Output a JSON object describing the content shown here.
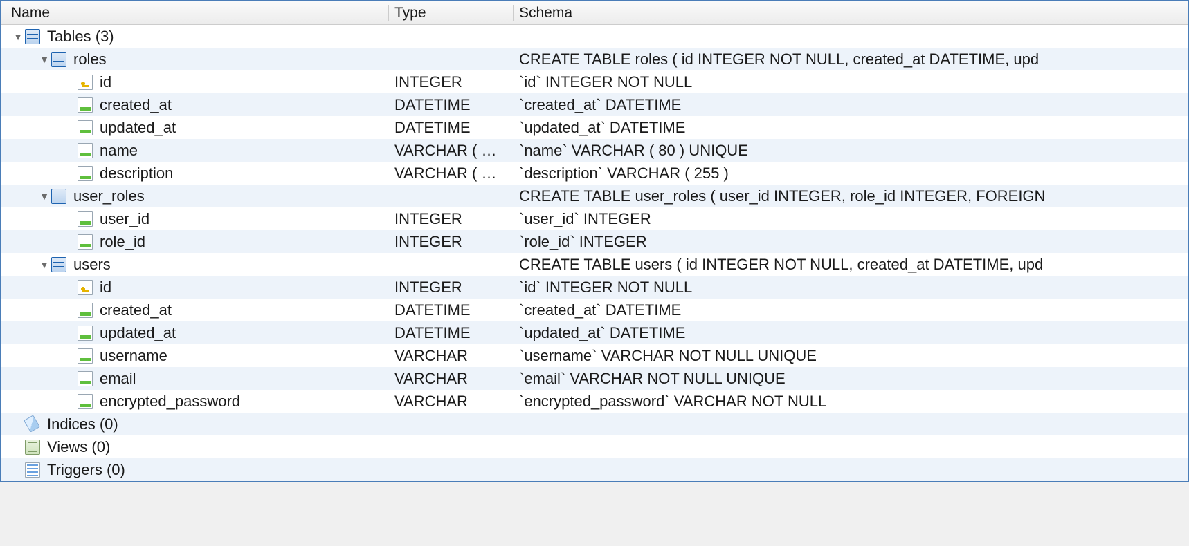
{
  "columns": {
    "name": "Name",
    "type": "Type",
    "schema": "Schema"
  },
  "tree": [
    {
      "depth": 0,
      "expand": "open",
      "icon": "table",
      "name": "Tables (3)",
      "type": "",
      "schema": ""
    },
    {
      "depth": 1,
      "expand": "open",
      "icon": "table",
      "name": "roles",
      "type": "",
      "schema": "CREATE TABLE roles ( id INTEGER NOT NULL, created_at DATETIME, upd"
    },
    {
      "depth": 2,
      "expand": "",
      "icon": "key",
      "name": "id",
      "type": "INTEGER",
      "schema": "`id` INTEGER NOT NULL"
    },
    {
      "depth": 2,
      "expand": "",
      "icon": "col",
      "name": "created_at",
      "type": "DATETIME",
      "schema": "`created_at` DATETIME"
    },
    {
      "depth": 2,
      "expand": "",
      "icon": "col",
      "name": "updated_at",
      "type": "DATETIME",
      "schema": "`updated_at` DATETIME"
    },
    {
      "depth": 2,
      "expand": "",
      "icon": "col",
      "name": "name",
      "type": "VARCHAR ( …",
      "schema": "`name` VARCHAR ( 80 ) UNIQUE"
    },
    {
      "depth": 2,
      "expand": "",
      "icon": "col",
      "name": "description",
      "type": "VARCHAR ( …",
      "schema": "`description` VARCHAR ( 255 )"
    },
    {
      "depth": 1,
      "expand": "open",
      "icon": "table",
      "name": "user_roles",
      "type": "",
      "schema": "CREATE TABLE user_roles ( user_id INTEGER, role_id INTEGER, FOREIGN"
    },
    {
      "depth": 2,
      "expand": "",
      "icon": "col",
      "name": "user_id",
      "type": "INTEGER",
      "schema": "`user_id` INTEGER"
    },
    {
      "depth": 2,
      "expand": "",
      "icon": "col",
      "name": "role_id",
      "type": "INTEGER",
      "schema": "`role_id` INTEGER"
    },
    {
      "depth": 1,
      "expand": "open",
      "icon": "table",
      "name": "users",
      "type": "",
      "schema": "CREATE TABLE users ( id INTEGER NOT NULL, created_at DATETIME, upd"
    },
    {
      "depth": 2,
      "expand": "",
      "icon": "key",
      "name": "id",
      "type": "INTEGER",
      "schema": "`id` INTEGER NOT NULL"
    },
    {
      "depth": 2,
      "expand": "",
      "icon": "col",
      "name": "created_at",
      "type": "DATETIME",
      "schema": "`created_at` DATETIME"
    },
    {
      "depth": 2,
      "expand": "",
      "icon": "col",
      "name": "updated_at",
      "type": "DATETIME",
      "schema": "`updated_at` DATETIME"
    },
    {
      "depth": 2,
      "expand": "",
      "icon": "col",
      "name": "username",
      "type": "VARCHAR",
      "schema": "`username` VARCHAR NOT NULL UNIQUE"
    },
    {
      "depth": 2,
      "expand": "",
      "icon": "col",
      "name": "email",
      "type": "VARCHAR",
      "schema": "`email` VARCHAR NOT NULL UNIQUE"
    },
    {
      "depth": 2,
      "expand": "",
      "icon": "col",
      "name": "encrypted_password",
      "type": "VARCHAR",
      "schema": "`encrypted_password` VARCHAR NOT NULL"
    },
    {
      "depth": 0,
      "expand": "",
      "icon": "index",
      "name": "Indices (0)",
      "type": "",
      "schema": ""
    },
    {
      "depth": 0,
      "expand": "",
      "icon": "view",
      "name": "Views (0)",
      "type": "",
      "schema": ""
    },
    {
      "depth": 0,
      "expand": "",
      "icon": "trigger",
      "name": "Triggers (0)",
      "type": "",
      "schema": ""
    }
  ]
}
